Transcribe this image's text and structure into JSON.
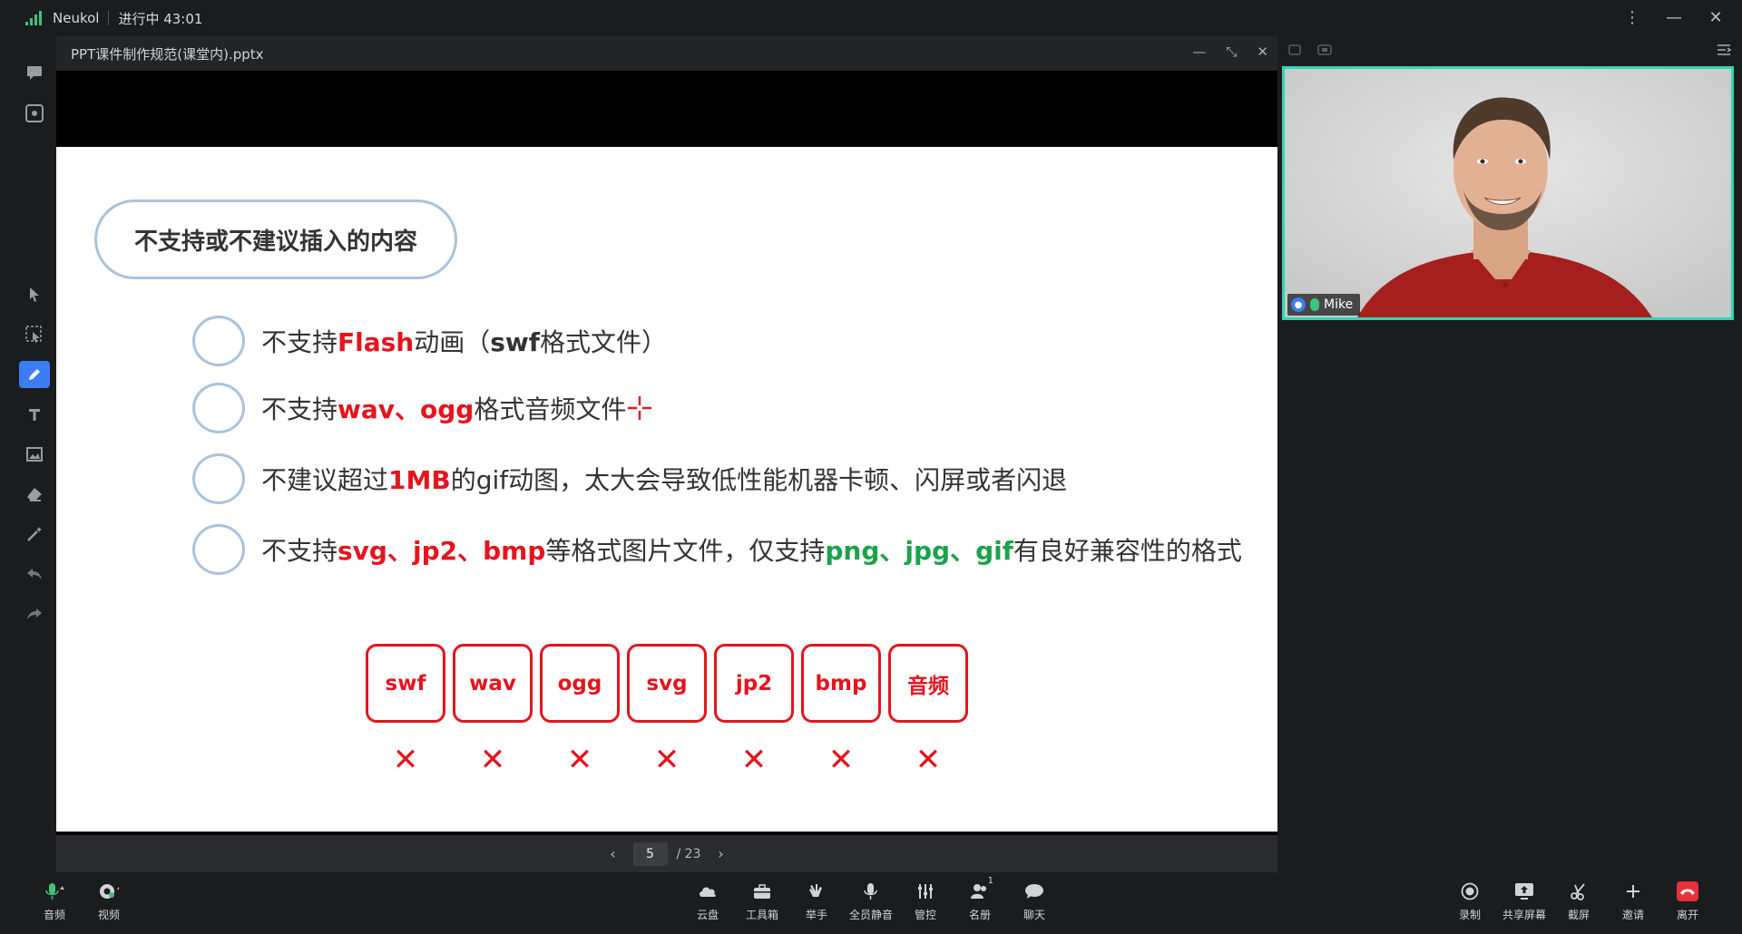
{
  "topbar": {
    "app_name": "Neukol",
    "call_status": "进行中 43:01",
    "more_icon": "⋮",
    "minimize_icon": "—",
    "close_icon": "✕"
  },
  "leftbar": {
    "tools": [
      "chat-icon",
      "screenshot-icon",
      "pointer-icon",
      "select-icon",
      "pen-icon",
      "text-icon",
      "image-icon",
      "eraser-icon",
      "magic-wand-icon",
      "undo-icon",
      "redo-icon"
    ],
    "active_tool": "pen-icon",
    "active_color": "#3c7cf4"
  },
  "document": {
    "title": "PPT课件制作规范(课堂内).pptx",
    "slide": {
      "heading": "不支持或不建议插入的内容",
      "bullets": [
        {
          "p1": "不支持",
          "r1": "Flash",
          "p2": "动画（",
          "b1": "swf",
          "p3": "格式文件）"
        },
        {
          "p1": "不支持",
          "r1": "wav、ogg",
          "p2": "格式音频文件"
        },
        {
          "p1": "不建议超过",
          "r1": "1MB",
          "p2": "的gif动图，太大会导致低性能机器卡顿、闪屏或者闪退"
        },
        {
          "p1": "不支持",
          "r1": "svg、jp2、bmp",
          "p2": "等格式图片文件，仅支持",
          "g1": "png、jpg、gif",
          "p3": "有良好兼容性的格式"
        }
      ],
      "formats": [
        "swf",
        "wav",
        "ogg",
        "svg",
        "jp2",
        "bmp",
        "音频"
      ],
      "mark": "✕",
      "accent_red": "#e5141d",
      "accent_green": "#1aa34a"
    },
    "pager": {
      "current": "5",
      "total": "/ 23"
    }
  },
  "video": {
    "participant_name": "Mike",
    "border_color": "#2fd6b4"
  },
  "bottombar": {
    "left": [
      {
        "label": "音频",
        "icon": "mic-icon"
      },
      {
        "label": "视频",
        "icon": "camera-icon"
      }
    ],
    "center": [
      {
        "label": "云盘",
        "icon": "cloud-icon"
      },
      {
        "label": "工具箱",
        "icon": "toolbox-icon"
      },
      {
        "label": "举手",
        "icon": "raise-hand-icon"
      },
      {
        "label": "全员静音",
        "icon": "mute-all-icon"
      },
      {
        "label": "管控",
        "icon": "controls-icon"
      },
      {
        "label": "名册",
        "icon": "roster-icon",
        "badge": "1"
      },
      {
        "label": "聊天",
        "icon": "chat-icon"
      }
    ],
    "right": [
      {
        "label": "录制",
        "icon": "record-icon"
      },
      {
        "label": "共享屏幕",
        "icon": "share-screen-icon"
      },
      {
        "label": "截屏",
        "icon": "scissors-icon"
      },
      {
        "label": "邀请",
        "icon": "plus-icon"
      },
      {
        "label": "离开",
        "icon": "leave-icon"
      }
    ]
  }
}
